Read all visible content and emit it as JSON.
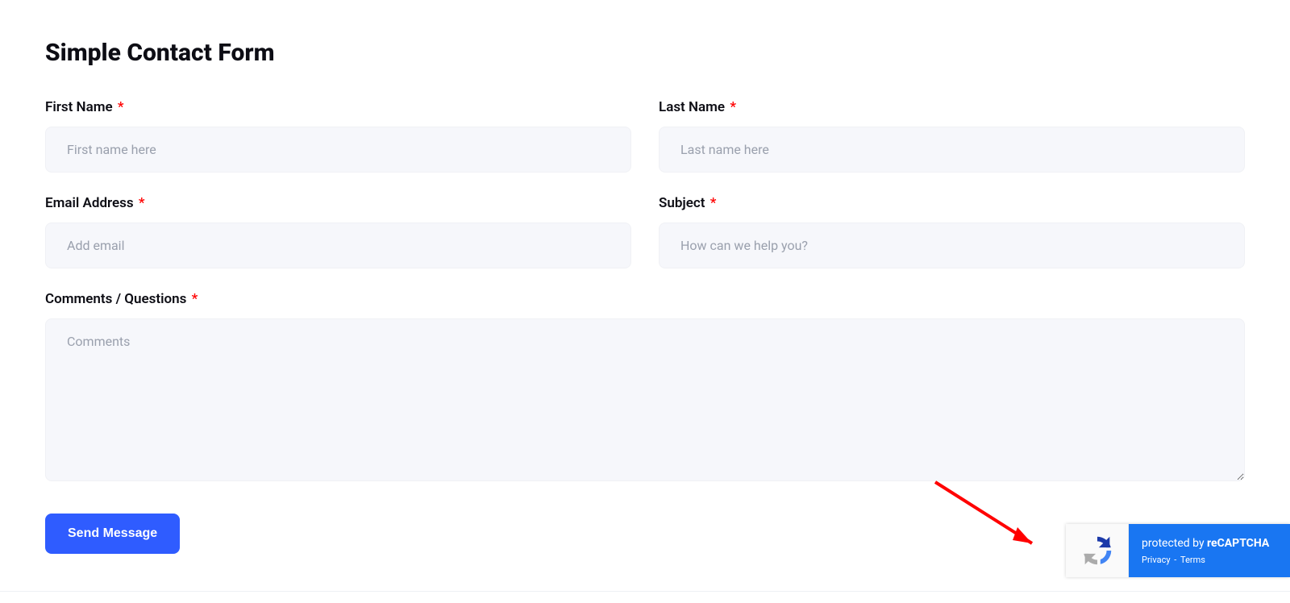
{
  "page": {
    "title": "Simple Contact Form"
  },
  "fields": {
    "first_name": {
      "label": "First Name",
      "placeholder": "First name here",
      "required": true
    },
    "last_name": {
      "label": "Last Name",
      "placeholder": "Last name here",
      "required": true
    },
    "email": {
      "label": "Email Address",
      "placeholder": "Add email",
      "required": true
    },
    "subject": {
      "label": "Subject",
      "placeholder": "How can we help you?",
      "required": true
    },
    "comments": {
      "label": "Comments / Questions",
      "placeholder": "Comments",
      "required": true
    }
  },
  "buttons": {
    "submit": "Send Message"
  },
  "recaptcha": {
    "title_prefix": "protected by ",
    "title_brand": "reCAPTCHA",
    "privacy": "Privacy",
    "dash": " - ",
    "terms": "Terms"
  },
  "required_marker": "*"
}
